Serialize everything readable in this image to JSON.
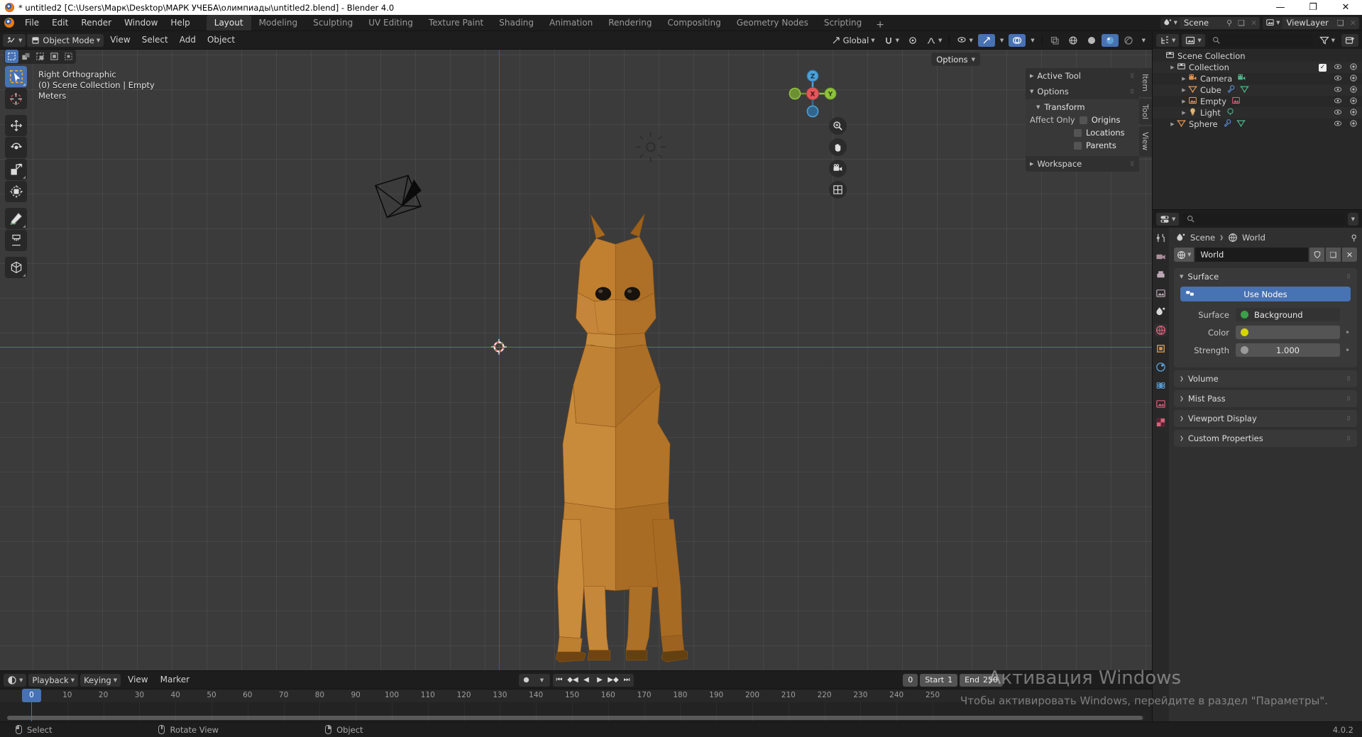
{
  "window": {
    "title": "* untitled2 [C:\\Users\\Марк\\Desktop\\МАРК УЧЕБА\\олимпиады\\untitled2.blend] - Blender 4.0",
    "minimize": "—",
    "maximize": "❐",
    "close": "✕"
  },
  "topbar": {
    "menus": [
      "File",
      "Edit",
      "Render",
      "Window",
      "Help"
    ],
    "workspaces": [
      {
        "label": "Layout",
        "active": true
      },
      {
        "label": "Modeling",
        "active": false
      },
      {
        "label": "Sculpting",
        "active": false
      },
      {
        "label": "UV Editing",
        "active": false
      },
      {
        "label": "Texture Paint",
        "active": false
      },
      {
        "label": "Shading",
        "active": false
      },
      {
        "label": "Animation",
        "active": false
      },
      {
        "label": "Rendering",
        "active": false
      },
      {
        "label": "Compositing",
        "active": false
      },
      {
        "label": "Geometry Nodes",
        "active": false
      },
      {
        "label": "Scripting",
        "active": false
      }
    ],
    "add_workspace": "+",
    "scene_name": "Scene",
    "viewlayer_name": "ViewLayer"
  },
  "viewport_header": {
    "mode": "Object Mode",
    "menus": [
      "View",
      "Select",
      "Add",
      "Object"
    ],
    "transform_orientation": "Global",
    "options_label": "Options"
  },
  "viewport": {
    "overlay_line1": "Right Orthographic",
    "overlay_line2": "(0) Scene Collection | Empty",
    "overlay_line3": "Meters",
    "gizmo_axes": {
      "x": "X",
      "y": "Y",
      "z": "Z"
    },
    "axis_colors": {
      "x": "#e3575b",
      "y": "#8fc13c",
      "z": "#4ba0d8"
    },
    "grid_color": "#3b3b3b",
    "model_color": "#c07a28"
  },
  "sidebar_panel": {
    "tabs": [
      {
        "label": "Item",
        "active": false
      },
      {
        "label": "Tool",
        "active": false
      },
      {
        "label": "View",
        "active": false
      }
    ],
    "sections": [
      {
        "label": "Active Tool",
        "expanded": false
      },
      {
        "label": "Options",
        "expanded": true
      },
      {
        "label": "Transform",
        "expanded": true
      },
      {
        "label": "Workspace",
        "expanded": false
      }
    ],
    "affect_only_label": "Affect Only",
    "affect_only_items": [
      "Origins",
      "Locations",
      "Parents"
    ]
  },
  "outliner": {
    "search_placeholder": "",
    "rows": [
      {
        "name": "Scene Collection",
        "indent": 0,
        "icon": "collection-icon",
        "has_tri": false,
        "eye": false,
        "camera": false
      },
      {
        "name": "Collection",
        "indent": 1,
        "icon": "collection-icon",
        "has_tri": true,
        "checkbox": true,
        "eye": true,
        "camera": true
      },
      {
        "name": "Camera",
        "indent": 2,
        "icon": "camera-icon",
        "has_tri": true,
        "eye": true,
        "camera": true
      },
      {
        "name": "Cube",
        "indent": 2,
        "icon": "mesh-icon",
        "has_tri": true,
        "eye": true,
        "camera": true
      },
      {
        "name": "Empty",
        "indent": 2,
        "icon": "image-empty-icon",
        "has_tri": true,
        "eye": true,
        "camera": true
      },
      {
        "name": "Light",
        "indent": 2,
        "icon": "light-icon",
        "has_tri": true,
        "eye": true,
        "camera": true
      },
      {
        "name": "Sphere",
        "indent": 1,
        "icon": "mesh-icon",
        "has_tri": true,
        "eye": true,
        "camera": true
      }
    ]
  },
  "properties": {
    "breadcrumb": [
      "Scene",
      "World"
    ],
    "id_name": "World",
    "use_nodes_label": "Use Nodes",
    "panels": [
      {
        "label": "Surface",
        "expanded": true
      },
      {
        "label": "Volume",
        "expanded": false
      },
      {
        "label": "Mist Pass",
        "expanded": false
      },
      {
        "label": "Viewport Display",
        "expanded": false
      },
      {
        "label": "Custom Properties",
        "expanded": false
      }
    ],
    "fields": [
      {
        "label": "Surface",
        "value": "Background",
        "swatch": "#3ba049",
        "type": "enum"
      },
      {
        "label": "Color",
        "value": "",
        "swatch": "#d6d400",
        "type": "color"
      },
      {
        "label": "Strength",
        "value": "1.000",
        "swatch": "#9a9a9a",
        "type": "number"
      }
    ]
  },
  "timeline": {
    "editor_menu": "",
    "menus": [
      "Playback",
      "Keying",
      "View",
      "Marker"
    ],
    "current_frame": "0",
    "start_label": "Start",
    "start_value": "1",
    "end_label": "End",
    "end_value": "250",
    "ticks": [
      0,
      10,
      20,
      30,
      40,
      50,
      60,
      70,
      80,
      90,
      100,
      110,
      120,
      130,
      140,
      150,
      160,
      170,
      180,
      190,
      200,
      210,
      220,
      230,
      240,
      250
    ],
    "playhead_frame": 0
  },
  "statusbar": {
    "items": [
      {
        "mouse": "left",
        "label": "Select"
      },
      {
        "mouse": "middle",
        "label": "Rotate View"
      },
      {
        "mouse": "right",
        "label": "Object"
      }
    ],
    "version": "4.0.2"
  },
  "watermark": {
    "line1": "Активация Windows",
    "line2": "Чтобы активировать Windows, перейдите в раздел \"Параметры\"."
  }
}
